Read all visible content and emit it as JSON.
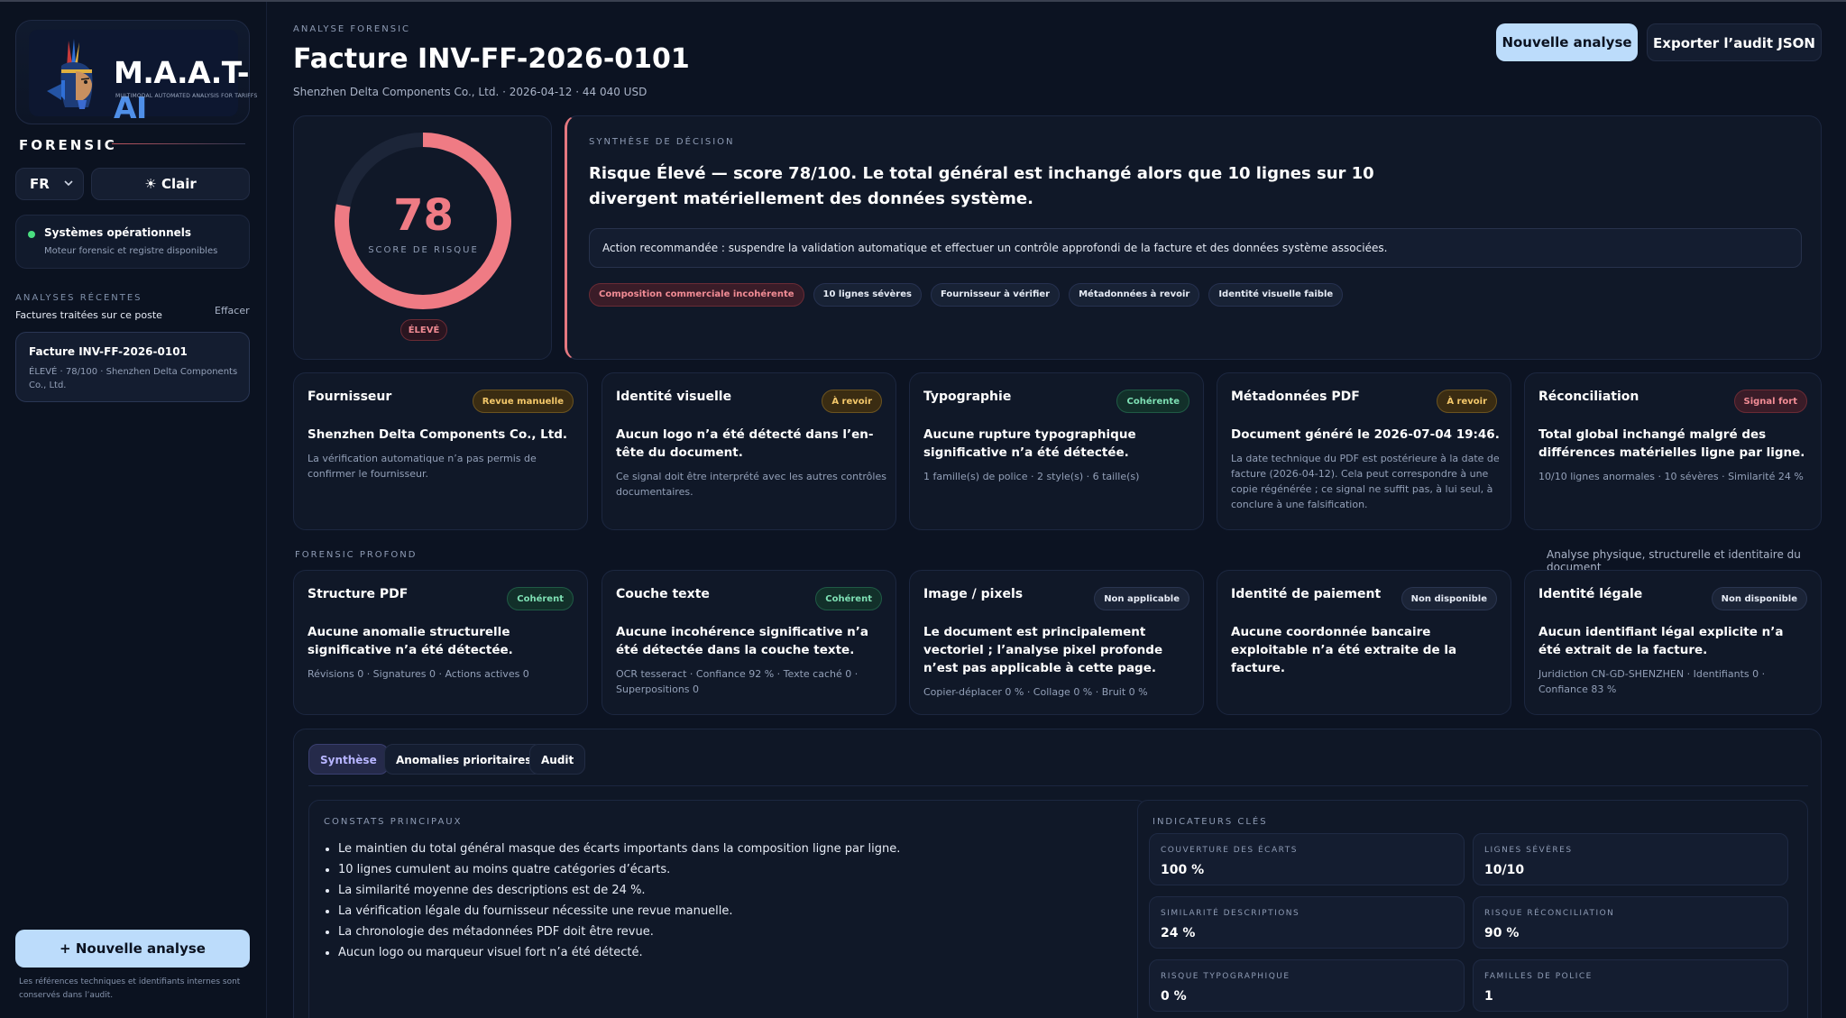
{
  "brand": {
    "logo_main": "M.A.A.T-",
    "logo_accent": "AI",
    "logo_sub": "MULTIMODAL AUTOMATED ANALYSIS FOR TARIFFS"
  },
  "sidebar": {
    "section_label": "FORENSIC",
    "language": "FR",
    "theme_label": "Clair",
    "status_title": "Systèmes opérationnels",
    "status_sub": "Moteur forensic et registre disponibles",
    "recent_label": "ANALYSES RÉCENTES",
    "recent_sub": "Factures traitées sur ce poste",
    "recent_clear": "Effacer",
    "recent_items": [
      {
        "title": "Facture INV-FF-2026-0101",
        "sub": "ÉLEVÉ · 78/100 · Shenzhen Delta Components Co., Ltd."
      }
    ],
    "new_analysis": "+ Nouvelle analyse",
    "footer": "Les références techniques et identifiants internes sont conservés dans l’audit."
  },
  "header": {
    "eyebrow": "ANALYSE FORENSIC",
    "title": "Facture INV-FF-2026-0101",
    "subtitle": "Shenzhen Delta Components Co., Ltd. · 2026-04-12 · 44 040 USD",
    "new_button": "Nouvelle analyse",
    "export_button": "Exporter l’audit JSON"
  },
  "score": {
    "value": "78",
    "fraction": 0.78,
    "label": "SCORE DE RISQUE",
    "level": "ÉLEVÉ",
    "color": "#ef7b84"
  },
  "decision": {
    "eyebrow": "SYNTHÈSE DE DÉCISION",
    "title": "Risque Élevé — score 78/100. Le total général est inchangé alors que 10 lignes sur 10 divergent matériellement des données système.",
    "action": "Action recommandée : suspendre la validation automatique et effectuer un contrôle approfondi de la facture et des données système associées.",
    "chips": [
      "Composition commerciale incohérente",
      "10 lignes sévères",
      "Fournisseur à vérifier",
      "Métadonnées à revoir",
      "Identité visuelle faible"
    ]
  },
  "cards": [
    {
      "title": "Fournisseur",
      "badge": "Revue manuelle",
      "head": "Shenzhen Delta Components Co., Ltd.",
      "body": "La vérification automatique n’a pas permis de confirmer le fournisseur."
    },
    {
      "title": "Identité visuelle",
      "badge": "À revoir",
      "head": "Aucun logo n’a été détecté dans l’en-tête du document.",
      "body": "Ce signal doit être interprété avec les autres contrôles documentaires."
    },
    {
      "title": "Typographie",
      "badge": "Cohérente",
      "head": "Aucune rupture typographique significative n’a été détectée.",
      "body": "1 famille(s) de police · 2 style(s) · 6 taille(s)"
    },
    {
      "title": "Métadonnées PDF",
      "badge": "À revoir",
      "head": "Document généré le 2026-07-04 19:46.",
      "body": "La date technique du PDF est postérieure à la date de facture (2026-04-12). Cela peut correspondre à une copie régénérée ; ce signal ne suffit pas, à lui seul, à conclure à une falsification."
    },
    {
      "title": "Réconciliation",
      "badge": "Signal fort",
      "head": "Total global inchangé malgré des différences matérielles ligne par ligne.",
      "body": "10/10 lignes anormales · 10 sévères · Similarité 24 %"
    }
  ],
  "deep": {
    "eyebrow": "FORENSIC PROFOND",
    "right": "Analyse physique, structurelle et identitaire du document",
    "cards": [
      {
        "title": "Structure PDF",
        "badge": "Cohérent",
        "head": "Aucune anomalie structurelle significative n’a été détectée.",
        "body": "Révisions 0 · Signatures 0 · Actions actives 0"
      },
      {
        "title": "Couche texte",
        "badge": "Cohérent",
        "head": "Aucune incohérence significative n’a été détectée dans la couche texte.",
        "body": "OCR tesseract · Confiance 92 % · Texte caché 0 · Superpositions 0"
      },
      {
        "title": "Image / pixels",
        "badge": "Non applicable",
        "head": "Le document est principalement vectoriel ; l’analyse pixel profonde n’est pas applicable à cette page.",
        "body": "Copier-déplacer 0 % · Collage 0 % · Bruit 0 %"
      },
      {
        "title": "Identité de paiement",
        "badge": "Non disponible",
        "head": "Aucune coordonnée bancaire exploitable n’a été extraite de la facture.",
        "body": ""
      },
      {
        "title": "Identité légale",
        "badge": "Non disponible",
        "head": "Aucun identifiant légal explicite n’a été extrait de la facture.",
        "body": "Juridiction CN-GD-SHENZHEN · Identifiants 0 · Confiance 83 %"
      }
    ]
  },
  "tabs": [
    "Synthèse",
    "Anomalies prioritaires",
    "Audit"
  ],
  "constats": {
    "eyebrow": "CONSTATS PRINCIPAUX",
    "items": [
      "Le maintien du total général masque des écarts importants dans la composition ligne par ligne.",
      "10 lignes cumulent au moins quatre catégories d’écarts.",
      "La similarité moyenne des descriptions est de 24 %.",
      "La vérification légale du fournisseur nécessite une revue manuelle.",
      "La chronologie des métadonnées PDF doit être revue.",
      "Aucun logo ou marqueur visuel fort n’a été détecté."
    ]
  },
  "indicators": {
    "eyebrow": "INDICATEURS CLÉS",
    "items": [
      {
        "label": "COUVERTURE DES ÉCARTS",
        "value": "100 %"
      },
      {
        "label": "LIGNES SÉVÈRES",
        "value": "10/10"
      },
      {
        "label": "SIMILARITÉ DESCRIPTIONS",
        "value": "24 %"
      },
      {
        "label": "RISQUE RÉCONCILIATION",
        "value": "90 %"
      },
      {
        "label": "RISQUE TYPOGRAPHIQUE",
        "value": "0 %"
      },
      {
        "label": "FAMILLES DE POLICE",
        "value": "1"
      }
    ]
  }
}
